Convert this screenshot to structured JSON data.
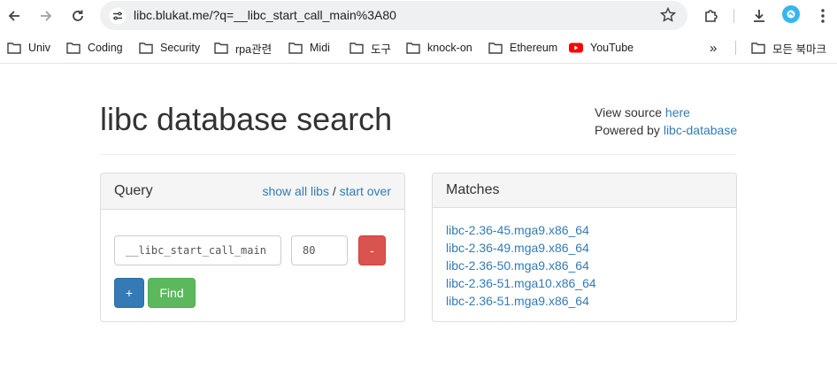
{
  "browser": {
    "url": "libc.blukat.me/?q=__libc_start_call_main%3A80",
    "bookmarks": [
      {
        "label": "Univ",
        "icon": "folder-icon"
      },
      {
        "label": "Coding",
        "icon": "folder-icon"
      },
      {
        "label": "Security",
        "icon": "folder-icon"
      },
      {
        "label": "rpa관련",
        "icon": "folder-icon"
      },
      {
        "label": "Midi",
        "icon": "folder-icon"
      },
      {
        "label": "도구",
        "icon": "folder-icon"
      },
      {
        "label": "knock-on",
        "icon": "folder-icon"
      },
      {
        "label": "Ethereum",
        "icon": "folder-icon"
      },
      {
        "label": "YouTube",
        "icon": "youtube-icon"
      }
    ],
    "overflow_label": "»",
    "all_bookmarks_label": "모든 북마크"
  },
  "page": {
    "title": "libc database search",
    "view_source_prefix": "View source",
    "view_source_link": "here",
    "powered_by_prefix": "Powered by",
    "powered_by_link": "libc-database"
  },
  "query": {
    "heading": "Query",
    "show_all_libs": "show all libs",
    "separator": "/",
    "start_over": "start over",
    "symbol_value": "__libc_start_call_main",
    "offset_value": "80",
    "remove_label": "-",
    "add_label": "+",
    "find_label": "Find"
  },
  "matches": {
    "heading": "Matches",
    "items": [
      "libc-2.36-45.mga9.x86_64",
      "libc-2.36-49.mga9.x86_64",
      "libc-2.36-50.mga9.x86_64",
      "libc-2.36-51.mga10.x86_64",
      "libc-2.36-51.mga9.x86_64"
    ]
  },
  "colors": {
    "link": "#337ab7",
    "danger": "#d9534f",
    "primary": "#337ab7",
    "success": "#5cb85c"
  }
}
